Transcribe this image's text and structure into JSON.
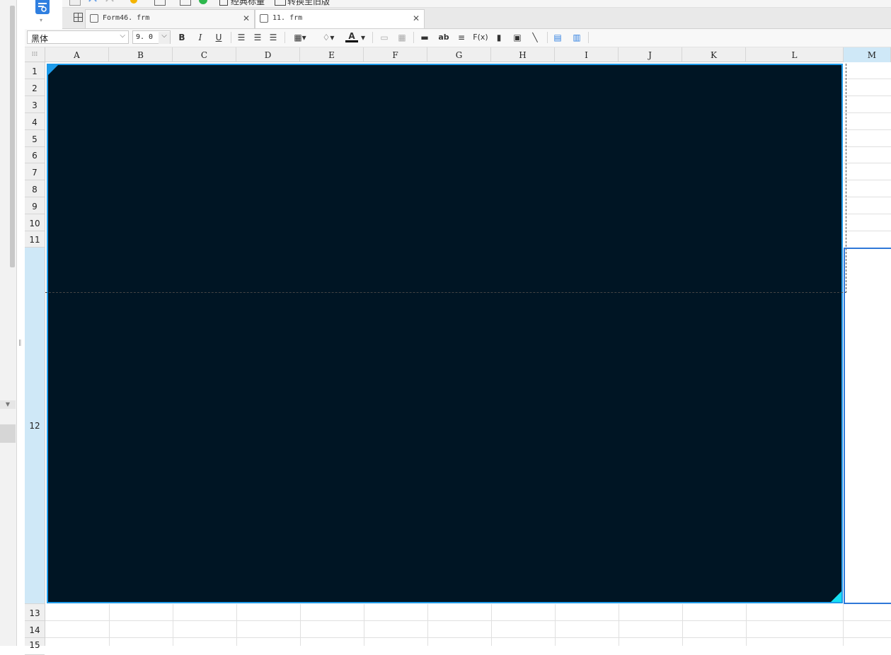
{
  "top_toolbar": {
    "classic_label": "经典标量",
    "convert_label": "转换至旧版"
  },
  "tabs": [
    {
      "label": "Form46. frm",
      "active": false
    },
    {
      "label": "11. frm",
      "active": true
    }
  ],
  "format_toolbar": {
    "font": "黑体",
    "size": "9. 0",
    "bold": "B",
    "italic": "I",
    "underline": "U",
    "text_ab": "ab",
    "formula": "F(x)",
    "font_color_glyph": "A",
    "font_color": "#000000"
  },
  "columns": [
    "A",
    "B",
    "C",
    "D",
    "E",
    "F",
    "G",
    "H",
    "I",
    "J",
    "K",
    "L",
    "M"
  ],
  "rows": [
    "1",
    "2",
    "3",
    "4",
    "5",
    "6",
    "7",
    "8",
    "9",
    "10",
    "11",
    "12",
    "13",
    "14",
    "15"
  ],
  "selection": {
    "column": "M",
    "row": "12"
  },
  "colors": {
    "widget_bg": "#001524",
    "widget_border": "#1e9bea",
    "widget_accent": "#16e0f2",
    "selection": "#2f78d8",
    "header_selected": "#cfe8f7"
  }
}
